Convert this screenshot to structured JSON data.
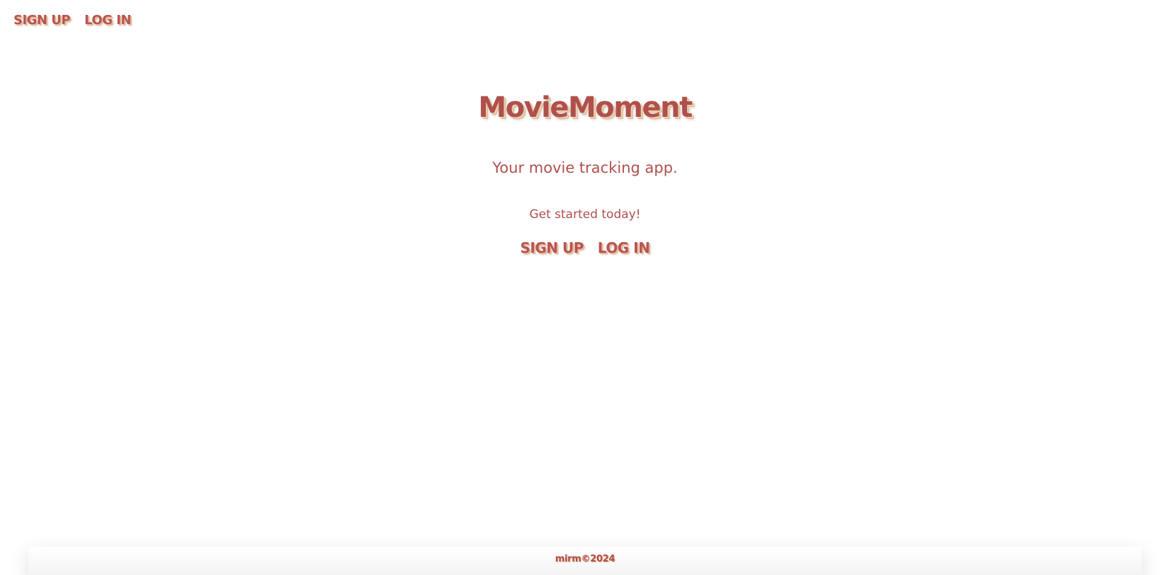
{
  "top_nav": {
    "signup_label": "SIGN UP",
    "login_label": "LOG IN"
  },
  "hero": {
    "title": "MovieMoment",
    "tagline": "Your movie tracking app.",
    "cta_text": "Get started today!",
    "signup_label": "SIGN UP",
    "login_label": "LOG IN"
  },
  "footer": {
    "text": "mirm©2024"
  },
  "colors": {
    "brand": "#b0504c",
    "shadow_accent": "#e0b68e",
    "background": "#ffffff"
  }
}
